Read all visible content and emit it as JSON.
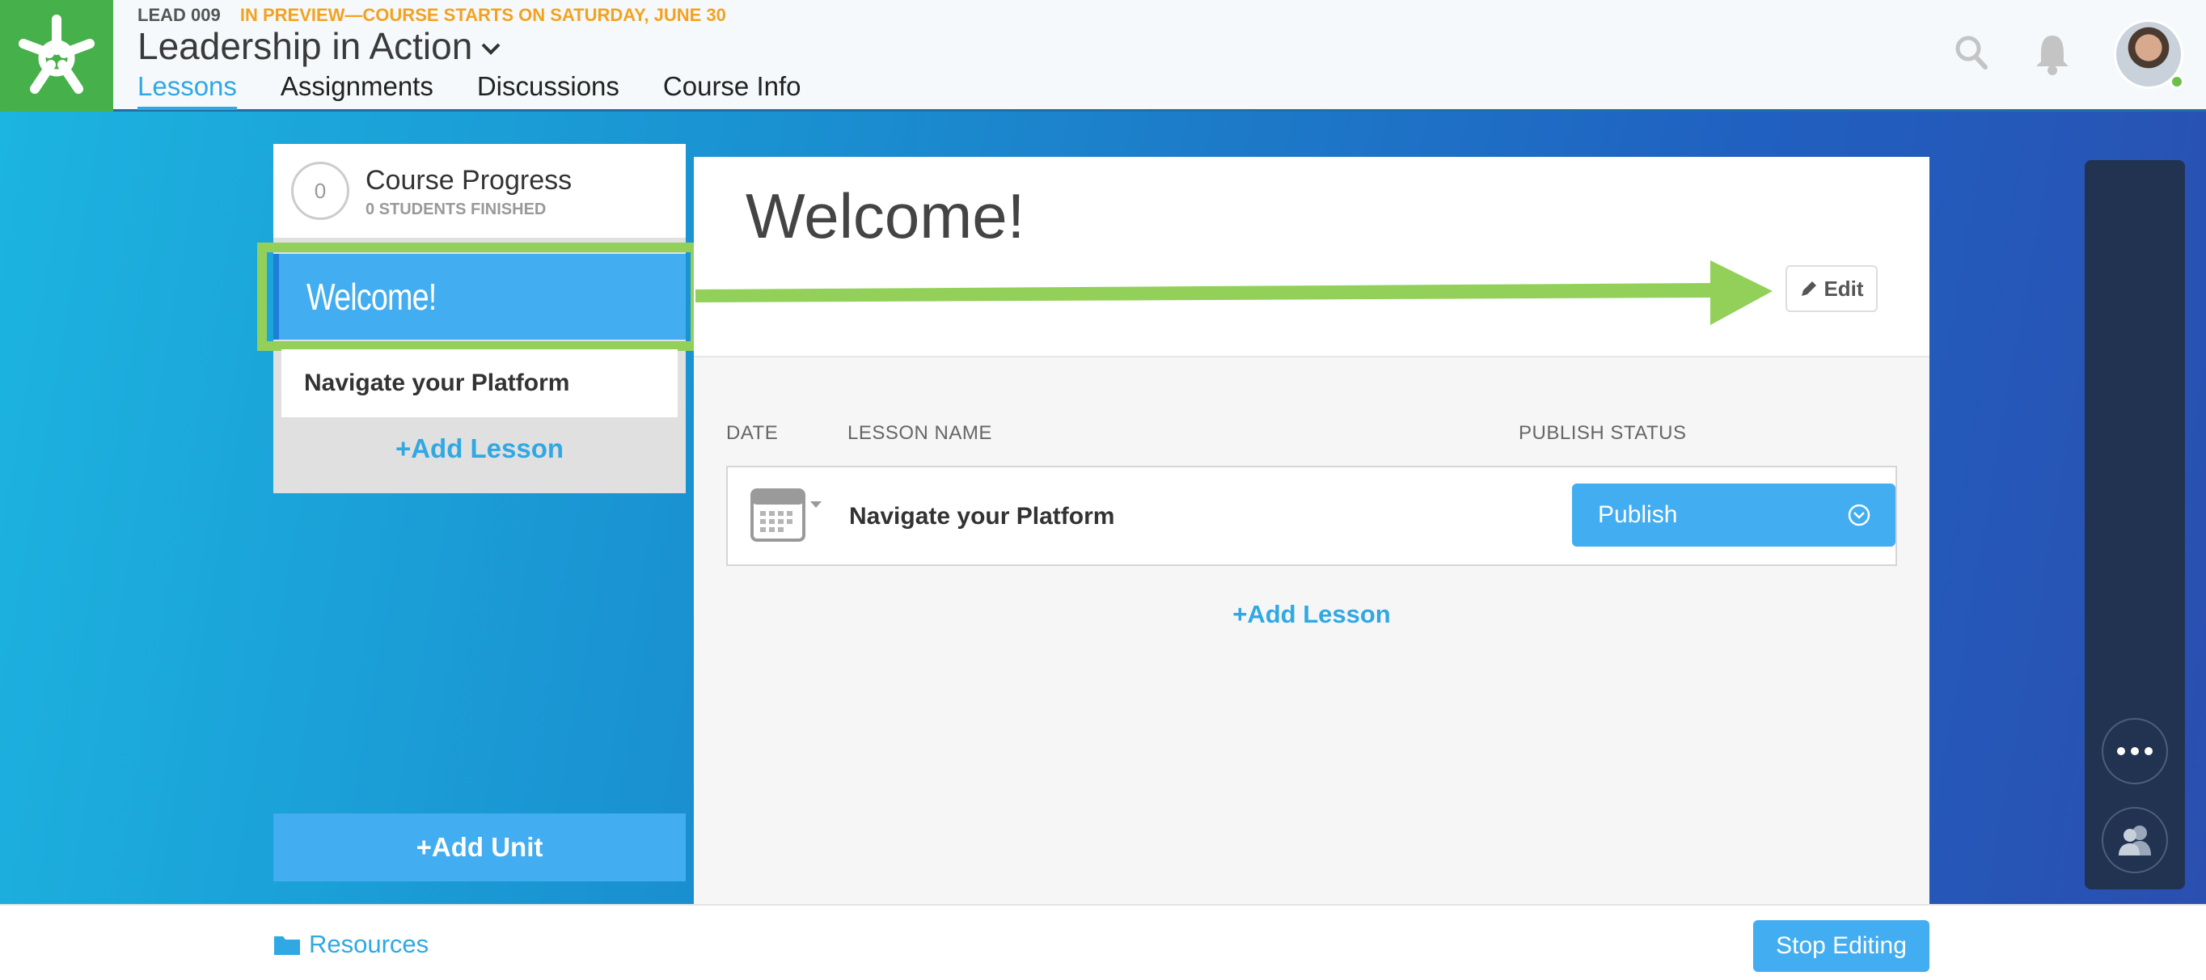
{
  "header": {
    "course_code": "LEAD 009",
    "preview_notice": "IN PREVIEW—COURSE STARTS ON SATURDAY, JUNE 30",
    "course_title": "Leadership in Action",
    "tabs": [
      {
        "label": "Lessons",
        "active": true
      },
      {
        "label": "Assignments",
        "active": false
      },
      {
        "label": "Discussions",
        "active": false
      },
      {
        "label": "Course Info",
        "active": false
      }
    ],
    "icons": [
      "search-icon",
      "bell-icon",
      "avatar"
    ]
  },
  "sidebar": {
    "progress": {
      "count": "0",
      "title": "Course Progress",
      "subtitle": "0 STUDENTS FINISHED"
    },
    "lessons": [
      {
        "label": "Welcome!",
        "active": true
      },
      {
        "label": "Navigate your Platform",
        "active": false
      }
    ],
    "add_lesson": "+Add Lesson",
    "add_unit": "+Add Unit"
  },
  "content": {
    "title": "Welcome!",
    "edit_label": "Edit",
    "columns": {
      "date": "DATE",
      "lesson_name": "LESSON NAME",
      "publish_status": "PUBLISH STATUS"
    },
    "rows": [
      {
        "name": "Navigate your Platform",
        "status": "Publish"
      }
    ],
    "add_lesson": "+Add Lesson"
  },
  "footer": {
    "resources": "Resources",
    "stop_editing": "Stop Editing"
  },
  "colors": {
    "accent": "#42adf0",
    "brand_green": "#46b04a",
    "highlight": "#92d05a",
    "preview_orange": "#f3a21f",
    "panel_dark": "#223352"
  }
}
